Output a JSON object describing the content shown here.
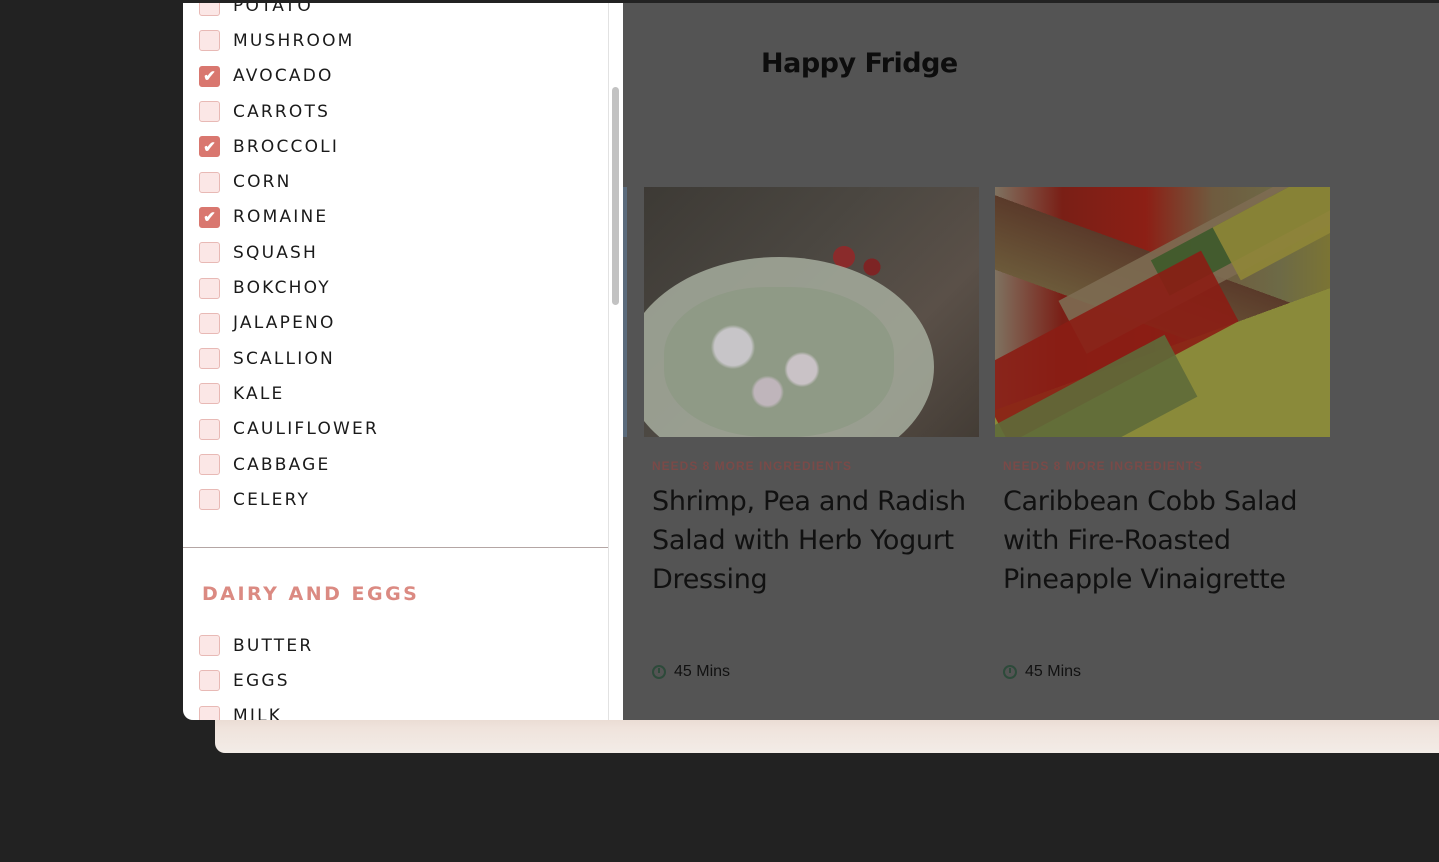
{
  "app_title": "Happy Fridge",
  "filters": {
    "vegetables": [
      {
        "label": "POTATO",
        "checked": false
      },
      {
        "label": "MUSHROOM",
        "checked": false
      },
      {
        "label": "AVOCADO",
        "checked": true
      },
      {
        "label": "CARROTS",
        "checked": false
      },
      {
        "label": "BROCCOLI",
        "checked": true
      },
      {
        "label": "CORN",
        "checked": false
      },
      {
        "label": "ROMAINE",
        "checked": true
      },
      {
        "label": "SQUASH",
        "checked": false
      },
      {
        "label": "BOKCHOY",
        "checked": false
      },
      {
        "label": "JALAPENO",
        "checked": false
      },
      {
        "label": "SCALLION",
        "checked": false
      },
      {
        "label": "KALE",
        "checked": false
      },
      {
        "label": "CAULIFLOWER",
        "checked": false
      },
      {
        "label": "CABBAGE",
        "checked": false
      },
      {
        "label": "CELERY",
        "checked": false
      }
    ],
    "dairy_heading": "DAIRY AND EGGS",
    "dairy": [
      {
        "label": "BUTTER",
        "checked": false
      },
      {
        "label": "EGGS",
        "checked": false
      },
      {
        "label": "MILK",
        "checked": false
      }
    ],
    "check_mark": "✔"
  },
  "recipes": [
    {
      "needs": "NEEDS 8 MORE INGREDIENTS",
      "title": "Shrimp, Pea and Radish Salad with Herb Yogurt Dressing",
      "time": "45 Mins"
    },
    {
      "needs": "NEEDS 8 MORE INGREDIENTS",
      "title": "Caribbean Cobb Salad with Fire-Roasted Pineapple Vinaigrette",
      "time": "45 Mins"
    }
  ]
}
